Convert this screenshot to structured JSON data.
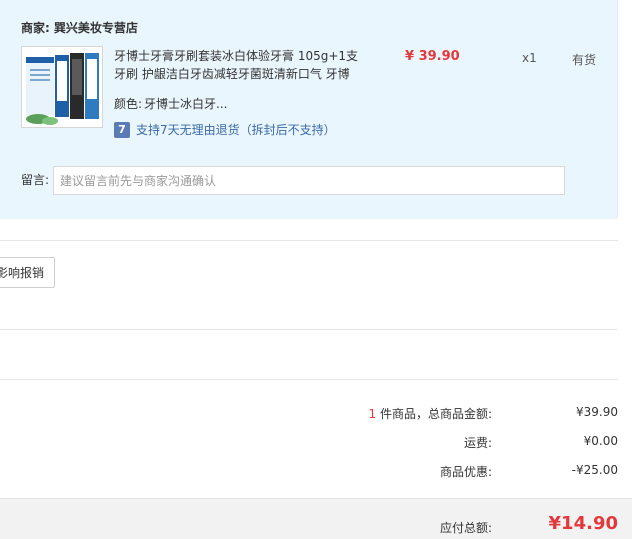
{
  "order": {
    "seller_label": "商家:",
    "seller_name": "巽兴美妆专营店",
    "product_title": "牙博士牙膏牙刷套装冰白体验牙膏 105g+1支牙刷 护龈洁白牙齿减轻牙菌斑清新口气 牙博",
    "price": "¥ 39.90",
    "quantity": "x1",
    "stock": "有货",
    "color_label": "颜色:",
    "color_value": "牙博士冰白牙...",
    "return_icon": "7",
    "return_policy": "支持7天无理由退货（拆封后不支持）",
    "note_label": "留言:",
    "note_placeholder": "建议留言前先与商家沟通确认",
    "note_value": ""
  },
  "invoice": {
    "button_label": "影响报销"
  },
  "summary": {
    "item_count": "1",
    "item_total_label": "件商品，总商品金额:",
    "item_total_value": "¥39.90",
    "shipping_label": "运费:",
    "shipping_value": "¥0.00",
    "discount_label": "商品优惠:",
    "discount_value": "-¥25.00",
    "payable_label": "应付总额:",
    "payable_value": "¥14.90"
  },
  "icons": {
    "return": "seven-day-return-icon",
    "product": "product-thumbnail"
  },
  "colors": {
    "accent": "#e4393c",
    "card_bg": "#eaf6fd",
    "link": "#3a6aa8"
  }
}
